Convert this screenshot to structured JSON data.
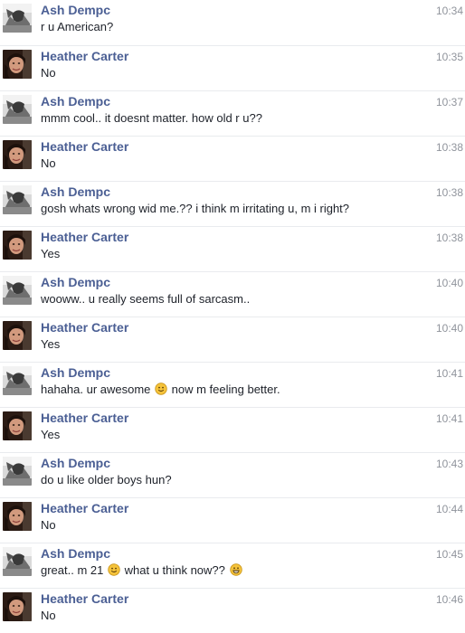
{
  "messages": [
    {
      "sender": "Ash Dempc",
      "avatar": "ash-avatar-icon",
      "time": "10:34",
      "parts": [
        {
          "t": "r u American?"
        }
      ]
    },
    {
      "sender": "Heather Carter",
      "avatar": "heather-avatar-icon",
      "time": "10:35",
      "parts": [
        {
          "t": "No"
        }
      ]
    },
    {
      "sender": "Ash Dempc",
      "avatar": "ash-avatar-icon",
      "time": "10:37",
      "parts": [
        {
          "t": "mmm cool.. it doesnt matter. how old r u??"
        }
      ]
    },
    {
      "sender": "Heather Carter",
      "avatar": "heather-avatar-icon",
      "time": "10:38",
      "parts": [
        {
          "t": "No"
        }
      ]
    },
    {
      "sender": "Ash Dempc",
      "avatar": "ash-avatar-icon",
      "time": "10:38",
      "parts": [
        {
          "t": "gosh whats wrong wid me.?? i think m irritating u, m i right?"
        }
      ]
    },
    {
      "sender": "Heather Carter",
      "avatar": "heather-avatar-icon",
      "time": "10:38",
      "parts": [
        {
          "t": "Yes"
        }
      ]
    },
    {
      "sender": "Ash Dempc",
      "avatar": "ash-avatar-icon",
      "time": "10:40",
      "parts": [
        {
          "t": "wooww.. u really seems full of sarcasm.."
        }
      ]
    },
    {
      "sender": "Heather Carter",
      "avatar": "heather-avatar-icon",
      "time": "10:40",
      "parts": [
        {
          "t": "Yes"
        }
      ]
    },
    {
      "sender": "Ash Dempc",
      "avatar": "ash-avatar-icon",
      "time": "10:41",
      "parts": [
        {
          "t": "hahaha. ur awesome "
        },
        {
          "emoji": "smile-emoji-icon"
        },
        {
          "t": " now m feeling better."
        }
      ]
    },
    {
      "sender": "Heather Carter",
      "avatar": "heather-avatar-icon",
      "time": "10:41",
      "parts": [
        {
          "t": "Yes"
        }
      ]
    },
    {
      "sender": "Ash Dempc",
      "avatar": "ash-avatar-icon",
      "time": "10:43",
      "parts": [
        {
          "t": "do u like older boys hun?"
        }
      ]
    },
    {
      "sender": "Heather Carter",
      "avatar": "heather-avatar-icon",
      "time": "10:44",
      "parts": [
        {
          "t": "No"
        }
      ]
    },
    {
      "sender": "Ash Dempc",
      "avatar": "ash-avatar-icon",
      "time": "10:45",
      "parts": [
        {
          "t": "great.. m 21 "
        },
        {
          "emoji": "smile-emoji-icon"
        },
        {
          "t": " what u think now?? "
        },
        {
          "emoji": "grin-emoji-icon"
        }
      ]
    },
    {
      "sender": "Heather Carter",
      "avatar": "heather-avatar-icon",
      "time": "10:46",
      "parts": [
        {
          "t": "No"
        }
      ]
    }
  ],
  "colors": {
    "sender": "#4b5f94",
    "text": "#1d2129",
    "time": "#90949c",
    "divider": "#e9ebee",
    "emoji": "#f5c33b"
  }
}
